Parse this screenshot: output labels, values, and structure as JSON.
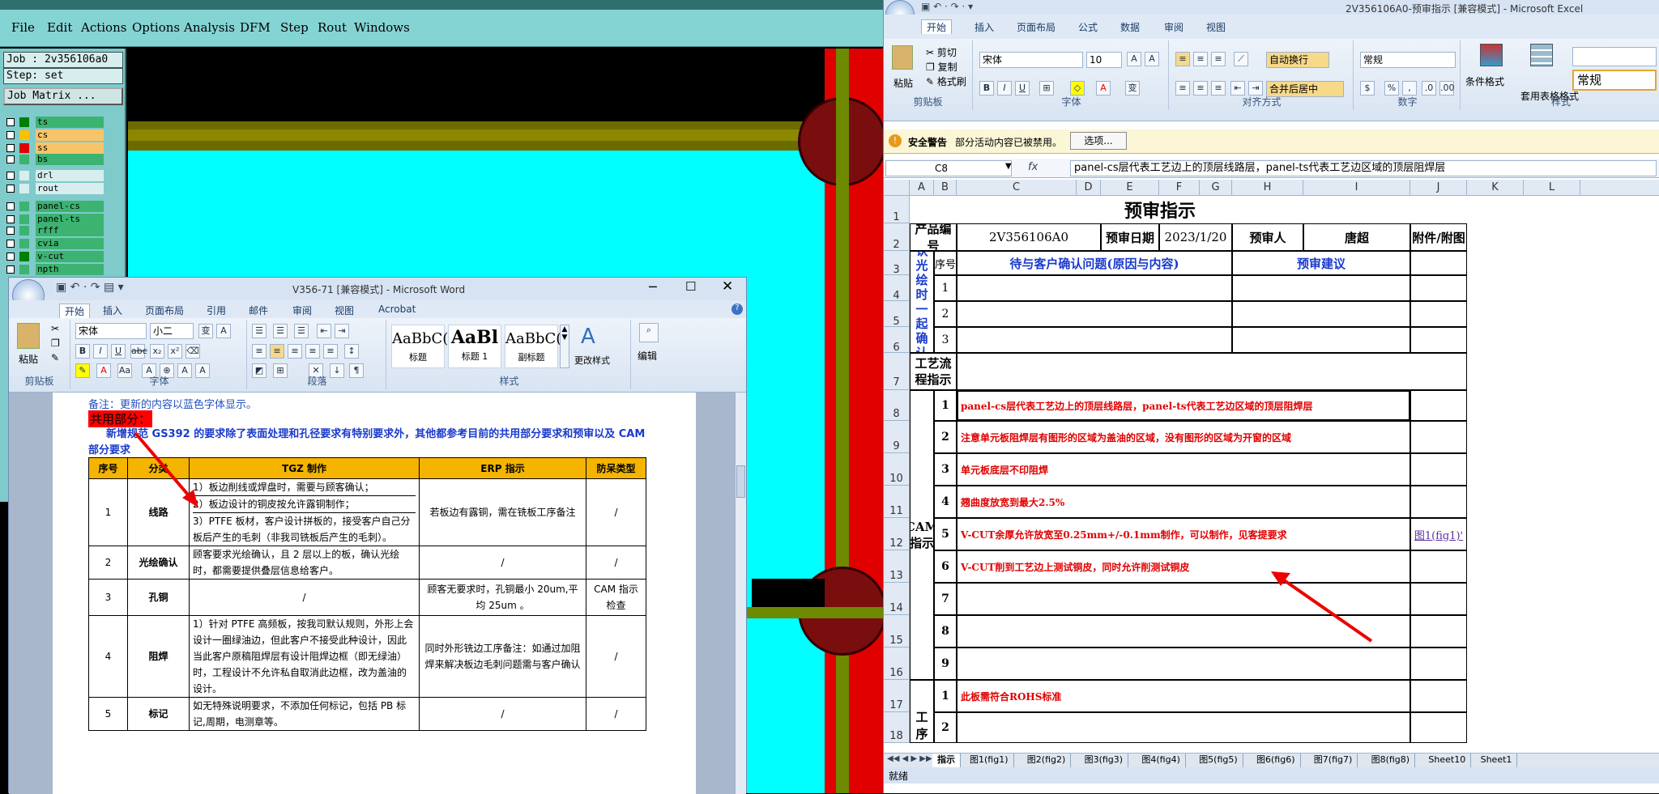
{
  "cam": {
    "menu": [
      "File",
      "Edit",
      "Actions",
      "Options",
      "Analysis",
      "DFM",
      "Step",
      "Rout",
      "Windows"
    ],
    "job_label": "Job : 2v356106a0",
    "step_label": "Step: set",
    "job_matrix_button": "Job Matrix ...",
    "layers": [
      {
        "name": "ts",
        "color": "#008000",
        "bg": "#3cb371"
      },
      {
        "name": "cs",
        "color": "#ffc000",
        "bg": "#f7c46a"
      },
      {
        "name": "ss",
        "color": "#e00000",
        "bg": "#f7c46a"
      },
      {
        "name": "bs",
        "color": "#3cb371",
        "bg": "#3cb371"
      },
      {
        "name": "drl",
        "color": "#d8eeee",
        "bg": "#d8eeee"
      },
      {
        "name": "rout",
        "color": "#d8eeee",
        "bg": "#d8eeee"
      },
      {
        "name": "panel-cs",
        "color": "#3cb371",
        "bg": "#3cb371"
      },
      {
        "name": "panel-ts",
        "color": "#3cb371",
        "bg": "#3cb371"
      },
      {
        "name": "rfff",
        "color": "#3cb371",
        "bg": "#3cb371"
      },
      {
        "name": "cvia",
        "color": "#3cb371",
        "bg": "#3cb371"
      },
      {
        "name": "v-cut",
        "color": "#008000",
        "bg": "#3cb371"
      },
      {
        "name": "npth",
        "color": "#3cb371",
        "bg": "#3cb371"
      }
    ]
  },
  "word": {
    "title": "V356-71 [兼容模式] - Microsoft Word",
    "tabs": [
      "开始",
      "插入",
      "页面布局",
      "引用",
      "邮件",
      "审阅",
      "视图",
      "Acrobat"
    ],
    "font_name": "宋体",
    "font_size": "小二",
    "styles": [
      {
        "preview": "AaBbC(",
        "label": "标题"
      },
      {
        "preview": "AaBl",
        "label": "标题 1"
      },
      {
        "preview": "AaBbC(",
        "label": "副标题"
      }
    ],
    "change_styles": "更改样式",
    "edit_label": "编辑",
    "paste_label": "粘贴",
    "groups": [
      "剪贴板",
      "字体",
      "段落",
      "样式"
    ],
    "note": "备注：更新的内容以蓝色字体显示。",
    "section_title": "共用部分：",
    "intro": "新增规范 GS392 的要求除了表面处理和孔径要求有特别要求外，其他都参考目前的共用部分要求和预审以及 CAM 部分要求",
    "table_headers": [
      "序号",
      "分类",
      "TGZ 制作",
      "ERP 指示",
      "防呆类型"
    ],
    "rows": [
      {
        "no": "1",
        "cat": "线路",
        "tgz": [
          "1）板边削线或焊盘时，需要与顾客确认；",
          "2）板边设计的铜皮按允许露铜制作；",
          "3）PTFE 板材，客户设计拼板的，接受客户自己分板后产生的毛刺（非我司铣板后产生的毛刺）。"
        ],
        "erp": "若板边有露铜，需在铣板工序备注",
        "fool": "/"
      },
      {
        "no": "2",
        "cat": "光绘确认",
        "tgz": [
          "顾客要求光绘确认，且 2 层以上的板，确认光绘时，都需要提供叠层信息给客户。"
        ],
        "erp": "/",
        "fool": "/"
      },
      {
        "no": "3",
        "cat": "孔铜",
        "tgz": [
          "/"
        ],
        "erp": "顾客无要求时，孔铜最小 20um,平均 25um 。",
        "fool": "CAM 指示检查"
      },
      {
        "no": "4",
        "cat": "阻焊",
        "tgz": [
          "1）针对 PTFE 高频板，按我司默认规则，外形上会设计一圈绿油边，但此客户不接受此种设计，因此当此客户原稿阻焊层有设计阻焊边框（即无绿油）时，工程设计不允许私自取消此边框，改为盖油的设计。"
        ],
        "erp": "同时外形铣边工序备注：如通过加阻焊来解决板边毛刺问题需与客户确认",
        "fool": "/"
      },
      {
        "no": "5",
        "cat": "标记",
        "tgz": [
          "如无特殊说明要求，不添加任何标记，包括 PB 标记,周期，电测章等。"
        ],
        "erp": "/",
        "fool": "/"
      }
    ]
  },
  "excel": {
    "title": "2V356106A0-预审指示 [兼容模式] - Microsoft Excel",
    "tabs": [
      "开始",
      "插入",
      "页面布局",
      "公式",
      "数据",
      "审阅",
      "视图"
    ],
    "clip": [
      "剪切",
      "复制",
      "格式刷",
      "粘贴",
      "剪贴板"
    ],
    "font_name": "宋体",
    "font_size": "10",
    "wrap": "自动换行",
    "merge": "合并后居中",
    "number_format": "常规",
    "cond_format": "条件格式",
    "table_format": "套用表格格式",
    "style_preview": "常规",
    "groups": [
      "剪贴板",
      "字体",
      "对齐方式",
      "数字",
      "样式"
    ],
    "warn_title": "安全警告",
    "warn_text": "部分活动内容已被禁用。",
    "options_button": "选项...",
    "name_box": "C8",
    "fx": "fx",
    "formula": "panel-cs层代表工艺边上的顶层线路层，panel-ts代表工艺边区域的顶层阻焊层",
    "cols": [
      "A",
      "B",
      "C",
      "D",
      "E",
      "F",
      "G",
      "H",
      "I",
      "J",
      "K",
      "L"
    ],
    "rows": [
      "1",
      "2",
      "3",
      "4",
      "5",
      "6",
      "7",
      "8",
      "9",
      "10",
      "11",
      "12",
      "13",
      "14",
      "15",
      "16",
      "17",
      "18"
    ],
    "sheet_title": "预审指示",
    "product_no_label": "产品编号",
    "product_no": "2V356106A0",
    "review_date_label": "预审日期",
    "review_date": "2023/1/20",
    "reviewer_label": "预审人",
    "reviewer": "唐超",
    "attach_label": "附件/附图",
    "seq": "序号",
    "confirm_label": "待与客户确认问题(原因与内容)",
    "suggest_label": "预审建议",
    "pending_label": "待确认光绘时一起确认问题",
    "flow_label": "工艺流程指示",
    "cam_label": "CAM指示",
    "craft_label": "工序",
    "cam_items": [
      "panel-cs层代表工艺边上的顶层线路层，panel-ts代表工艺边区域的顶层阻焊层",
      "注意单元板阻焊层有图形的区域为盖油的区域，没有图形的区域为开窗的区域",
      "单元板底层不印阻焊",
      "翘曲度放宽到最大2.5%",
      "V-CUT余厚允许放宽至0.25mm+/-0.1mm制作，可以制作，见客提要求",
      "V-CUT削到工艺边上测试铜皮，同时允许削测试铜皮",
      "",
      "",
      ""
    ],
    "link_text": "图1(fig1)'",
    "craft_items": [
      "此板需符合ROHS标准",
      ""
    ],
    "sheets": [
      "指示",
      "图1(fig1)",
      "图2(fig2)",
      "图3(fig3)",
      "图4(fig4)",
      "图5(fig5)",
      "图6(fig6)",
      "图7(fig7)",
      "图8(fig8)",
      "Sheet10",
      "Sheet1"
    ],
    "status": "就绪"
  }
}
